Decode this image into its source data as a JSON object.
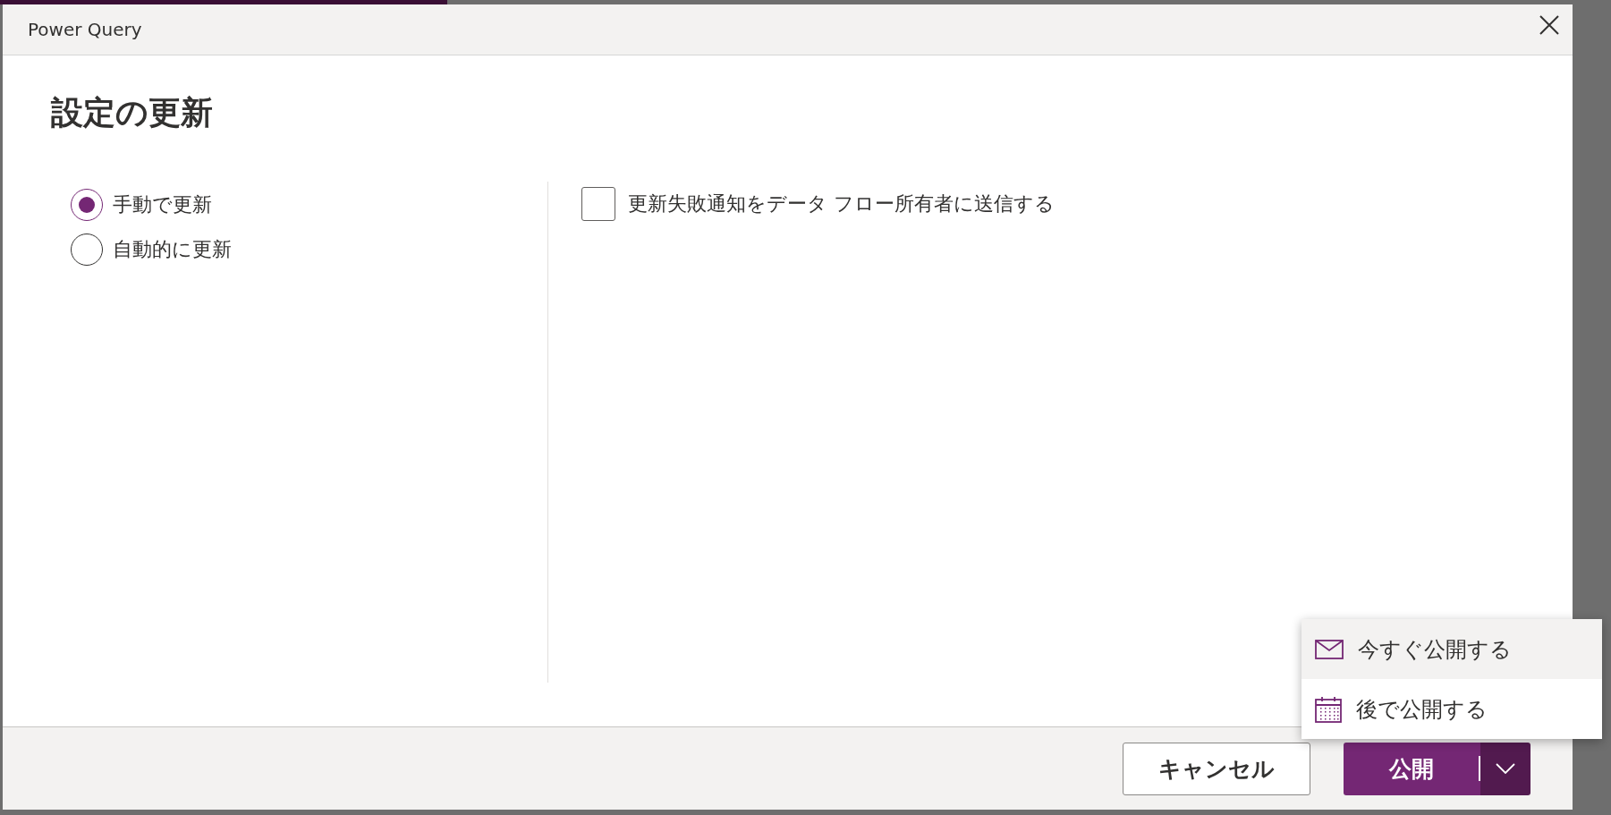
{
  "dialog": {
    "title": "Power Query",
    "heading": "設定の更新",
    "refresh_options": [
      {
        "label": "手動で更新",
        "selected": true
      },
      {
        "label": "自動的に更新",
        "selected": false
      }
    ],
    "notify_checkbox": {
      "label": "更新失敗通知をデータ フロー所有者に送信する",
      "checked": false
    },
    "publish_menu": [
      {
        "kind": "mail",
        "label": "今すぐ公開する",
        "selected": true
      },
      {
        "kind": "calendar",
        "label": "後で公開する",
        "selected": false
      }
    ],
    "buttons": {
      "cancel": "キャンセル",
      "publish": "公開"
    }
  }
}
